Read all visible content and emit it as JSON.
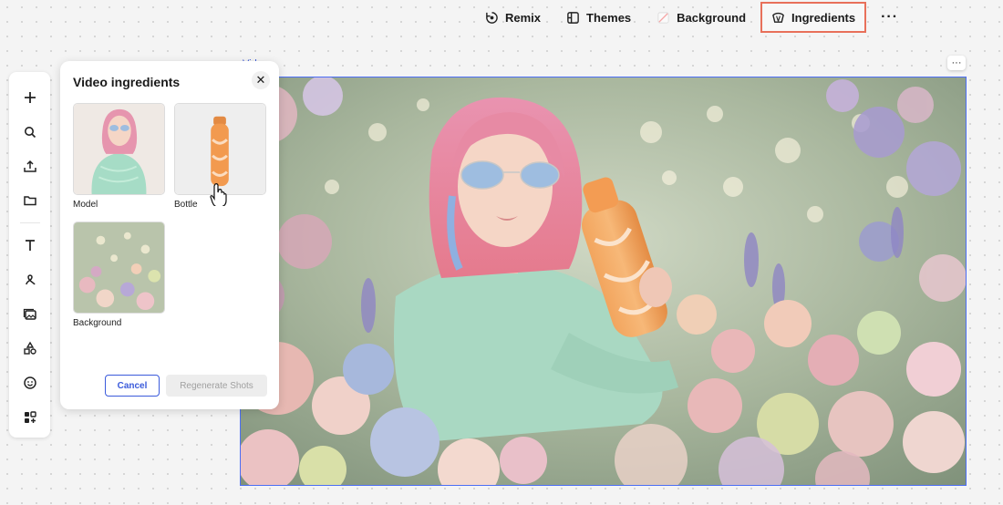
{
  "toolbar": {
    "remix_label": "Remix",
    "themes_label": "Themes",
    "background_label": "Background",
    "ingredients_label": "Ingredients",
    "more_label": "···",
    "active_border_color": "#e8705a"
  },
  "rail": {
    "icons": [
      "add-icon",
      "search-icon",
      "upload-icon",
      "folder-icon",
      "text-icon",
      "draw-icon",
      "media-icon",
      "shapes-icon",
      "emoji-icon",
      "apps-icon"
    ]
  },
  "panel": {
    "title": "Video ingredients",
    "close_label": "✕",
    "items": [
      {
        "label": "Model"
      },
      {
        "label": "Bottle"
      },
      {
        "label": "Background"
      }
    ],
    "cancel_label": "Cancel",
    "regenerate_label": "Regenerate Shots"
  },
  "canvas": {
    "frame_label": "Video",
    "more_label": "···",
    "accent_color": "#4c6ef5"
  }
}
